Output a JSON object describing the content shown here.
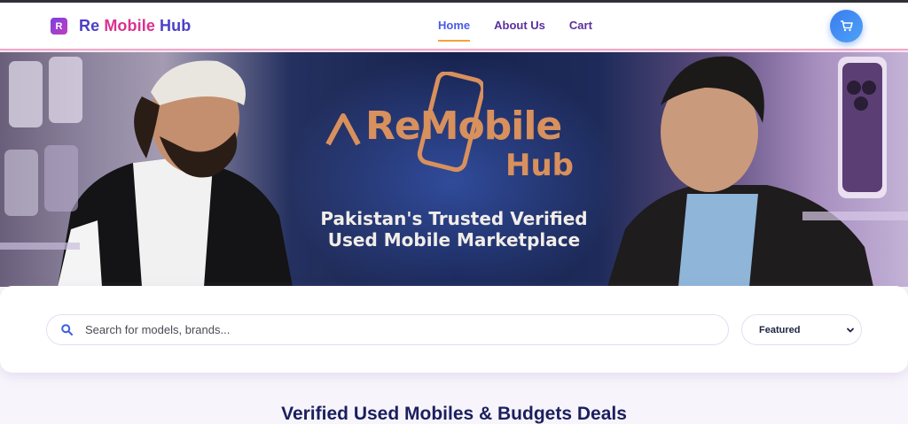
{
  "brand": {
    "logo_letter": "R",
    "name_part1": "Re",
    "name_part2": "Mobile",
    "name_part3": "Hub"
  },
  "nav": {
    "items": [
      {
        "label": "Home",
        "active": true
      },
      {
        "label": "About Us",
        "active": false
      },
      {
        "label": "Cart",
        "active": false
      }
    ]
  },
  "cart": {
    "icon": "cart-icon"
  },
  "hero": {
    "logo_text_1": "ReMobile",
    "logo_text_2": "Hub",
    "tagline_1": "Pakistan's Trusted Verified",
    "tagline_2": "Used Mobile Marketplace"
  },
  "search": {
    "placeholder": "Search for models, brands...",
    "value": "",
    "icon": "search-icon"
  },
  "sort": {
    "selected": "Featured"
  },
  "section": {
    "title": "Verified Used Mobiles & Budgets Deals"
  },
  "colors": {
    "accent": "#4a5be8",
    "brand_pink": "#d9328f",
    "brand_purple": "#4b3fc7",
    "underline": "#f3a33b",
    "cart_button": "#3a7bf0"
  }
}
